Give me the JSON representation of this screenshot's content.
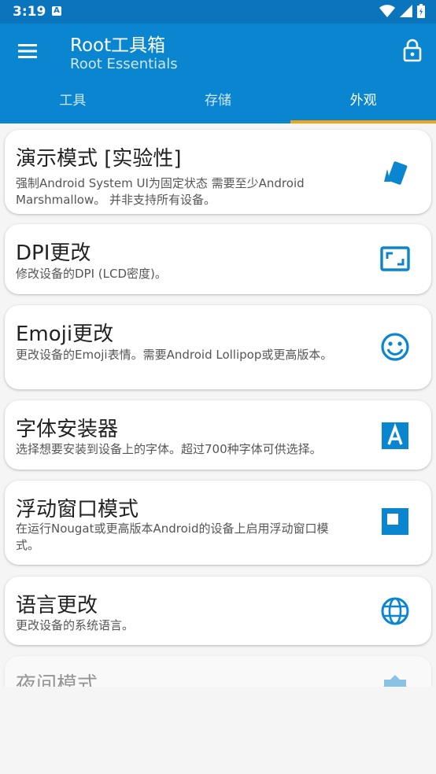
{
  "status": {
    "time": "3:19",
    "badge": "A"
  },
  "appbar": {
    "title": "Root工具箱",
    "subtitle": "Root Essentials"
  },
  "tabs": [
    {
      "label": "工具"
    },
    {
      "label": "存储"
    },
    {
      "label": "外观",
      "active": true
    }
  ],
  "items": [
    {
      "title": "演示模式 [实验性]",
      "desc": "强制Android System UI为固定状态 需要至少Android Marshmallow。 并非支持所有设备。",
      "icon": "cards-icon"
    },
    {
      "title": "DPI更改",
      "desc": "修改设备的DPI (LCD密度)。",
      "icon": "aspect-ratio-icon"
    },
    {
      "title": "Emoji更改",
      "desc": "更改设备的Emoji表情。需要Android Lollipop或更高版本。",
      "icon": "smiley-icon"
    },
    {
      "title": "字体安装器",
      "desc": "选择想要安装到设备上的字体。超过700种字体可供选择。",
      "icon": "font-icon"
    },
    {
      "title": "浮动窗口模式",
      "desc": "在运行Nougat或更高版本Android的设备上启用浮动窗口模式。",
      "icon": "floating-window-icon"
    },
    {
      "title": "语言更改",
      "desc": "更改设备的系统语言。",
      "icon": "globe-icon"
    },
    {
      "title": "夜间模式",
      "desc": "",
      "icon": "night-mode-icon"
    }
  ],
  "colors": {
    "primary": "#0a86d1",
    "status_bar": "#0a75bd",
    "accent": "#f2a31a",
    "icon": "#0a86d1"
  }
}
